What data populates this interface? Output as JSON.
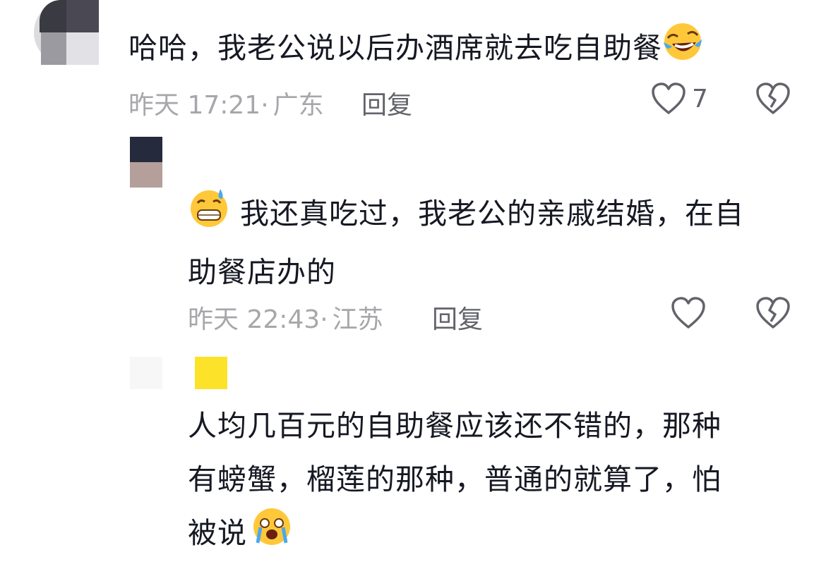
{
  "comments": [
    {
      "text": "哈哈，我老公说以后办酒席就去吃自助餐",
      "emoji": "laughing-tears-emoji",
      "time": "昨天 17:21",
      "sep": "·",
      "location": "广东",
      "reply_label": "回复",
      "like_count": "7"
    },
    {
      "emoji": "sweat-grin-emoji",
      "text_line1": "我还真吃过，我老公的亲戚结婚，在自",
      "text_line2": "助餐店办的",
      "time": "昨天 22:43",
      "sep": "·",
      "location": "江苏",
      "reply_label": "回复"
    },
    {
      "text_line1": "人均几百元的自助餐应该还不错的，那种",
      "text_line2": "有螃蟹，榴莲的那种，普通的就算了，怕",
      "text_line3": "被说",
      "emoji": "crying-emoji"
    }
  ],
  "colors": {
    "text": "#161823",
    "meta": "#a7a7ab",
    "action": "#62636a",
    "badge_yellow": "#fde22a"
  },
  "icons": [
    "heart-outline-icon",
    "broken-heart-icon"
  ]
}
